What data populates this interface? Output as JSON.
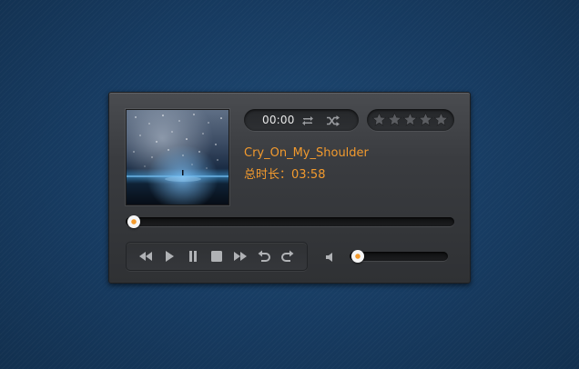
{
  "player": {
    "current_time": "00:00",
    "song_title": "Cry_On_My_Shoulder",
    "duration_label": "总时长：03:58",
    "rating": {
      "value": 0,
      "max": 5
    },
    "progress": 0,
    "volume": 0
  },
  "colors": {
    "accent": "#f29a2e",
    "background": "#173b61",
    "panel": "#3a3c40"
  },
  "icons": {
    "repeat": "repeat-icon",
    "shuffle": "shuffle-icon",
    "star": "star-icon",
    "rewind": "rewind-icon",
    "play": "play-icon",
    "pause": "pause-icon",
    "stop": "stop-icon",
    "fast_forward": "fast-forward-icon",
    "undo": "undo-icon",
    "redo": "redo-icon",
    "volume": "volume-icon"
  }
}
